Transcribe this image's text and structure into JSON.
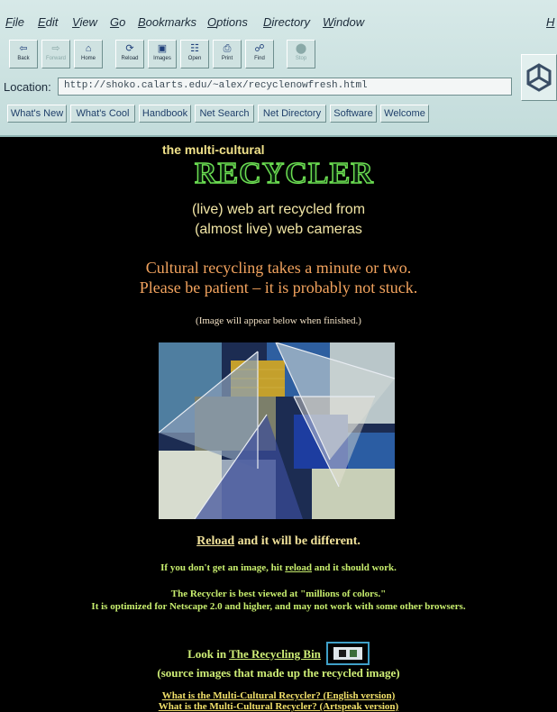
{
  "menubar": {
    "items": [
      "File",
      "Edit",
      "View",
      "Go",
      "Bookmarks",
      "Options",
      "Directory",
      "Window"
    ],
    "help": "H"
  },
  "toolbar": {
    "buttons": [
      {
        "label": "Back",
        "icon": "back-arrow-icon"
      },
      {
        "label": "Forward",
        "icon": "forward-arrow-icon"
      },
      {
        "label": "Home",
        "icon": "home-icon"
      },
      {
        "label": "Reload",
        "icon": "reload-icon"
      },
      {
        "label": "Images",
        "icon": "images-icon"
      },
      {
        "label": "Open",
        "icon": "open-icon"
      },
      {
        "label": "Print",
        "icon": "print-icon"
      },
      {
        "label": "Find",
        "icon": "find-icon"
      },
      {
        "label": "Stop",
        "icon": "stop-icon"
      }
    ]
  },
  "location": {
    "label": "Location:",
    "url": "http://shoko.calarts.edu/~alex/recyclenowfresh.html"
  },
  "directory_buttons": [
    "What's New",
    "What's Cool",
    "Handbook",
    "Net Search",
    "Net Directory",
    "Software",
    "Welcome"
  ],
  "page": {
    "small_title": "the multi-cultural",
    "big_title": "RECYCLER",
    "subtitle_line1": "(live) web art recycled from",
    "subtitle_line2": "(almost live) web cameras",
    "notice_line1": "Cultural recycling takes a minute or two.",
    "notice_line2": "Please be patient – it is probably not stuck.",
    "image_note": "(Image will appear below when finished.)",
    "reload_link": "Reload",
    "reload_rest": " and it will be different.",
    "no_image_before": "If you don't get an image, hit ",
    "no_image_link": "reload",
    "no_image_after": " and it should work.",
    "colors_line1": "The Recycler is best viewed at \"millions of colors.\"",
    "colors_line2": "It is optimized for Netscape 2.0 and higher, and may not work with some other browsers.",
    "bin_before": "Look in ",
    "bin_link": "The Recycling Bin",
    "bin_line2": "(source images that made up the recycled image)",
    "link_english": "What is the Multi-Cultural Recycler? (English version)",
    "link_artspeak": "What is the Multi-Cultural Recycler? (Artspeak version)"
  },
  "colors": {
    "chrome_bg": "#c3dcdb",
    "page_bg": "#000000",
    "title_green": "#6cde52",
    "notice_orange": "#f2a35e",
    "text_green": "#c8ee6e"
  }
}
